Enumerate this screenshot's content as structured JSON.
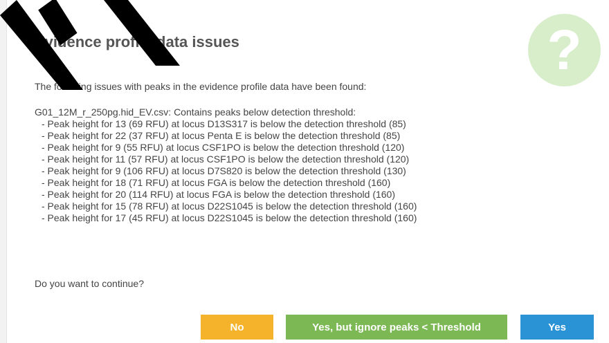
{
  "dialog": {
    "title": "Evidence profile data issues",
    "intro": "The following issues with peaks in the evidence profile data have been found:",
    "file_line": "G01_12M_r_250pg.hid_EV.csv: Contains peaks below detection threshold:",
    "issues": [
      "- Peak height for 13 (69 RFU) at locus D13S317 is below the detection threshold (85)",
      "- Peak height for 22 (37 RFU) at locus Penta E is below the detection threshold (85)",
      "- Peak height for 9 (55 RFU) at locus CSF1PO is below the detection threshold (120)",
      "- Peak height for 11 (57 RFU) at locus CSF1PO is below the detection threshold (120)",
      "- Peak height for 9 (106 RFU) at locus D7S820 is below the detection threshold (130)",
      "- Peak height for 18 (71 RFU) at locus FGA is below the detection threshold (160)",
      "- Peak height for 20 (114 RFU) at locus FGA is below the detection threshold (160)",
      "- Peak height for 15 (78 RFU) at locus D22S1045 is below the detection threshold (160)",
      "- Peak height for 17 (45 RFU) at locus D22S1045 is below the detection threshold (160)"
    ],
    "question": "Do you want to continue?",
    "icon": "question-icon",
    "buttons": {
      "no": "No",
      "ignore": "Yes, but ignore peaks < Threshold",
      "yes": "Yes"
    }
  },
  "watermark": {
    "text": "AI"
  },
  "colors": {
    "no_button": "#f4b32a",
    "ignore_button": "#7cb854",
    "yes_button": "#2a93d5",
    "help_badge": "#d8eecb",
    "watermark": "#000000"
  }
}
